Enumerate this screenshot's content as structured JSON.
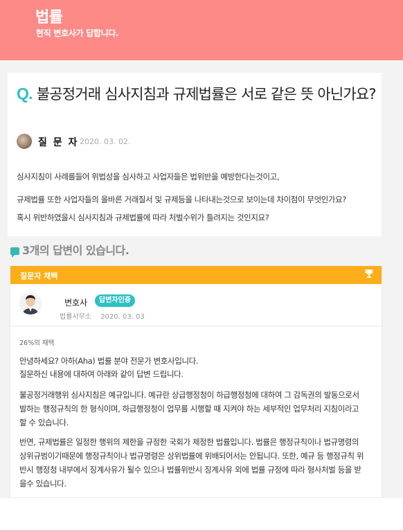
{
  "header": {
    "title": "법률",
    "subtitle": "현직 변호사가 답합니다."
  },
  "question": {
    "q_mark": "Q.",
    "title": "불공정거래 심사지침과 규제법률은 서로 같은 뜻 아닌가요?",
    "asker_name": "질 문 자",
    "date": "2020. 03. 02.",
    "body": [
      "심사지침이 사례를들어 위법성을 심사하고 사업자들은 법위반을 예방한다는것이고,",
      "규제법률 또한 사업자들의 올바른 거래질서 및 규제등을 나타내는것으로 보이는데 차이점이 무엇인가요?",
      "혹시 위반하였을시 심사지침과 규제법률에 따라 처벌수위가 틀려지는 것인지요?"
    ]
  },
  "answers_count_label": "3개의 답변이 있습니다.",
  "answer": {
    "chosen_label": "질문자 채택",
    "lawyer_name": "변호사",
    "badge": "답변자인증",
    "office": "법률사무소",
    "date": "2020. 03. 03",
    "chosen_pct": "26%의 채택",
    "body": [
      "안녕하세요? 아하(Aha) 법률 분야 전문가            변호사입니다.",
      "질문하신 내용에 대하여 아래와 같이 답변 드립니다.",
      "불공정거래행위 심사지침은 예규입니다. 예규란 상급행정청이 하급행정청에 대하여 그 감독권의 발동으로서",
      "발하는 행정규칙의 한 형식이며, 하급행정청이 업무를 시행할 때 지켜야 하는 세부적인 업무처리 지침이라고",
      "할 수 있습니다.",
      "반면, 규제법률은 일정한 행위의 제한을 규정한 국회가 제정한 법률입니다. 법률은 행정규칙이나 법규명령의",
      "상위규범이기때문에 행정규칙이나 법규명령은 상위법률에 위배되어서는 안됩니다. 또한, 예규 등 행정규칙 위",
      "반시 행정청 내부에서 징계사유가 될수 있으나 법률위반시 징계사유 외에 법률 규정에 따라 형사처벌 등을 받",
      "을수 있습니다."
    ]
  },
  "colors": {
    "header_bg": "#fd8a86",
    "accent": "#2ec0c4",
    "chosen_bar": "#fbae1a"
  }
}
